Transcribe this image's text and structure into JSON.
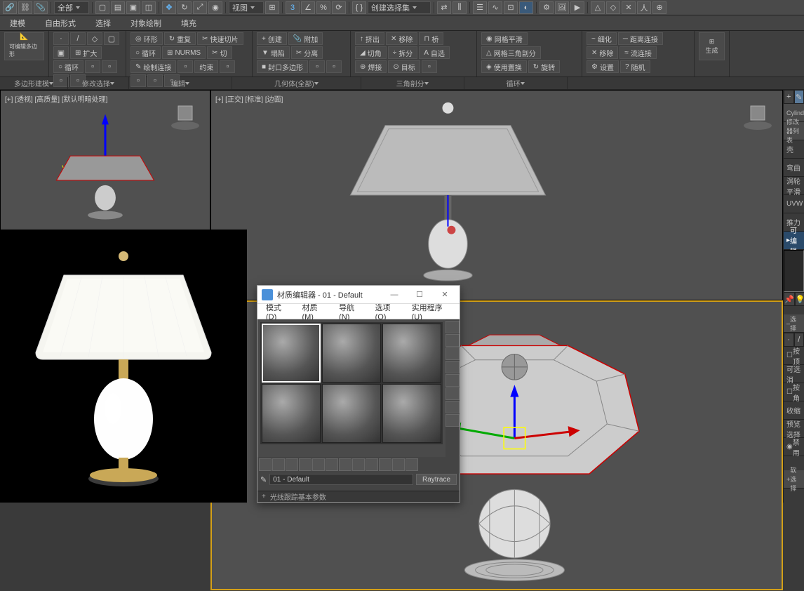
{
  "toolbar": {
    "scope_dropdown": "全部",
    "view_dropdown": "视图",
    "select_set": "创建选择集"
  },
  "menu": {
    "items": [
      "建模",
      "自由形式",
      "选择",
      "对象绘制",
      "填充"
    ]
  },
  "ribbon": {
    "group1": {
      "label": "多边形建模",
      "edit_btn": "可编辑多边形"
    },
    "group2": {
      "label": "修改选择",
      "expand": "扩大",
      "loop": "循环",
      "ring": "环形"
    },
    "group3": {
      "label": "编辑",
      "repeat": "重复",
      "nurms": "NURMS",
      "constraint": "约束",
      "quickslice": "快速切片",
      "cut": "切",
      "paint": "绘制连接",
      "loop2": "循环"
    },
    "group4": {
      "label": "几何体(全部)",
      "create": "创建",
      "attach": "附加",
      "collapse": "塌陷",
      "detach": "分离",
      "seal": "封口多边形"
    },
    "group5": {
      "label": "",
      "extrude": "挤出",
      "chamfer": "切角",
      "weld": "焊接",
      "remove": "移除",
      "split": "拆分",
      "target": "目标",
      "bridge": "桥",
      "autos": "自选"
    },
    "group6": {
      "label": "三角剖分",
      "mesh_smooth": "网格平滑",
      "tri_split": "网格三角剖分",
      "use_disp": "使用置换",
      "rotate": "旋转"
    },
    "group7": {
      "label": "循环",
      "relax": "细化",
      "conn_edge": "距离连接",
      "conn_flow": "流连接",
      "remove2": "移除",
      "setup": "设置",
      "random": "随机"
    },
    "group8": {
      "label": "",
      "gen": "生成"
    }
  },
  "tabs": {
    "poly_model": "多边形建模",
    "modify_sel": "修改选择",
    "edit": "编辑",
    "geom": "几何体(全部)",
    "tri": "三角剖分",
    "loop": "循环"
  },
  "viewports": {
    "tl_label": "[+] [透视] [高质量] [默认明暗处理]",
    "tr_label": "[+] [正交] [标准] [边面]",
    "br_label": ""
  },
  "right_panel": {
    "object_name": "Cylinder",
    "modifier_header": "修改器列表",
    "items": [
      "壳",
      "弯曲",
      "涡轮平滑",
      "UVW",
      "推力"
    ],
    "editable": "可编辑",
    "select_header": "选择",
    "by_vertex": "按顶",
    "ignore_back": "可选消",
    "by_angle": "按角",
    "shrink": "收缩",
    "preview": "预览选择",
    "disable": "禁用",
    "soft_sel": "软选择"
  },
  "material_editor": {
    "title": "材质编辑器 - 01 - Default",
    "menu": [
      "模式(D)",
      "材质(M)",
      "导航(N)",
      "选项(O)",
      "实用程序(U)"
    ],
    "material_name": "01 - Default",
    "material_type": "Raytrace",
    "footer": "光线跟踪基本参数"
  }
}
